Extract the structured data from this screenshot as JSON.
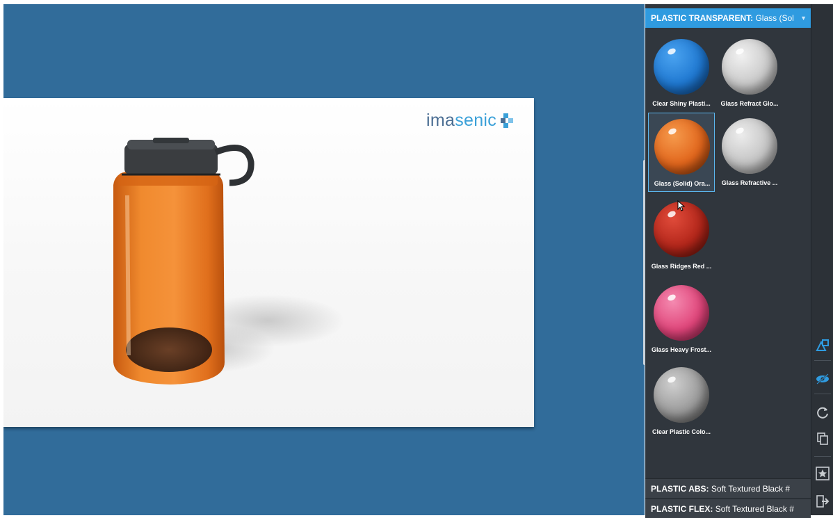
{
  "viewer": {
    "logo_text_a": "ima",
    "logo_text_b": "senic",
    "colors": {
      "background": "#316c9a",
      "bottle": "#e8721c",
      "cap": "#3a3d40"
    }
  },
  "materials_panel": {
    "header_category": "PLASTIC TRANSPARENT:",
    "header_value": "Glass (Sol",
    "header_caret": "▼",
    "tiles": [
      {
        "label": "Clear Shiny Plasti...",
        "color": "#1f78d1",
        "selected": false
      },
      {
        "label": "Glass Refract Glo...",
        "color": "#c9c9c9",
        "selected": false
      },
      {
        "label": "Glass (Solid) Ora...",
        "color": "#e2661c",
        "selected": true
      },
      {
        "label": "Glass Refractive ...",
        "color": "#c4c4c4",
        "selected": false
      },
      {
        "label": "Glass Ridges Red ...",
        "color": "#b3261a",
        "selected": false
      },
      {
        "label": "Glass Heavy Frost...",
        "color": "#e0457a",
        "selected": false
      },
      {
        "label": "Clear Plastic Colo...",
        "color": "#9a9a9a",
        "selected": false
      }
    ],
    "sections": [
      {
        "category": "PLASTIC ABS:",
        "value": "Soft Textured Black #"
      },
      {
        "category": "PLASTIC FLEX:",
        "value": "Soft Textured Black #"
      }
    ]
  },
  "toolstrip": {
    "icons": [
      "shapes-icon",
      "eye-hidden-icon",
      "refresh-icon",
      "copy-icon",
      "favorites-star-icon",
      "exit-icon"
    ]
  }
}
